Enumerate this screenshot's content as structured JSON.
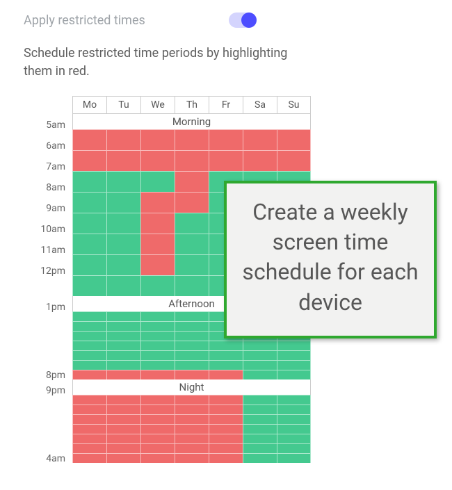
{
  "header": {
    "title": "Apply restricted times",
    "toggle_on": true
  },
  "description": "Schedule restricted time periods by highlighting them in red.",
  "days": [
    "Mo",
    "Tu",
    "We",
    "Th",
    "Fr",
    "Sa",
    "Su"
  ],
  "sections": {
    "morning": {
      "label": "Morning",
      "rows": [
        {
          "label": "5am",
          "cells": [
            "r",
            "r",
            "r",
            "r",
            "r",
            "r",
            "r"
          ]
        },
        {
          "label": "6am",
          "cells": [
            "r",
            "r",
            "r",
            "r",
            "r",
            "r",
            "r"
          ]
        },
        {
          "label": "7am",
          "cells": [
            "g",
            "g",
            "g",
            "r",
            "g",
            "g",
            "g"
          ]
        },
        {
          "label": "8am",
          "cells": [
            "g",
            "g",
            "r",
            "r",
            "g",
            "g",
            "g"
          ]
        },
        {
          "label": "9am",
          "cells": [
            "g",
            "g",
            "r",
            "g",
            "g",
            "g",
            "g"
          ]
        },
        {
          "label": "10am",
          "cells": [
            "g",
            "g",
            "r",
            "g",
            "g",
            "g",
            "g"
          ]
        },
        {
          "label": "11am",
          "cells": [
            "g",
            "g",
            "r",
            "g",
            "g",
            "g",
            "g"
          ]
        },
        {
          "label": "12pm",
          "cells": [
            "g",
            "g",
            "g",
            "g",
            "g",
            "g",
            "g"
          ]
        }
      ]
    },
    "afternoon": {
      "label": "Afternoon",
      "top_label": "1pm",
      "bottom_label": "8pm",
      "rows": [
        {
          "cells": [
            "g",
            "g",
            "g",
            "g",
            "g",
            "g",
            "g"
          ]
        },
        {
          "cells": [
            "g",
            "g",
            "g",
            "g",
            "g",
            "g",
            "g"
          ]
        },
        {
          "cells": [
            "g",
            "g",
            "g",
            "g",
            "g",
            "g",
            "g"
          ]
        },
        {
          "cells": [
            "g",
            "g",
            "g",
            "g",
            "g",
            "g",
            "g"
          ]
        },
        {
          "cells": [
            "g",
            "g",
            "g",
            "g",
            "g",
            "g",
            "g"
          ]
        },
        {
          "cells": [
            "g",
            "g",
            "g",
            "g",
            "g",
            "g",
            "g"
          ]
        },
        {
          "cells": [
            "r",
            "r",
            "r",
            "r",
            "r",
            "g",
            "g"
          ]
        }
      ]
    },
    "night": {
      "label": "Night",
      "top_label": "9pm",
      "bottom_label": "4am",
      "rows": [
        {
          "cells": [
            "r",
            "r",
            "r",
            "r",
            "r",
            "g",
            "g"
          ]
        },
        {
          "cells": [
            "r",
            "r",
            "r",
            "r",
            "r",
            "g",
            "g"
          ]
        },
        {
          "cells": [
            "r",
            "r",
            "r",
            "r",
            "r",
            "g",
            "g"
          ]
        },
        {
          "cells": [
            "r",
            "r",
            "r",
            "r",
            "r",
            "g",
            "g"
          ]
        },
        {
          "cells": [
            "r",
            "r",
            "r",
            "r",
            "r",
            "g",
            "g"
          ]
        },
        {
          "cells": [
            "r",
            "r",
            "r",
            "r",
            "r",
            "g",
            "g"
          ]
        },
        {
          "cells": [
            "r",
            "r",
            "r",
            "r",
            "r",
            "g",
            "g"
          ]
        }
      ]
    }
  },
  "callout": "Create a weekly screen time schedule for each device",
  "colors": {
    "restricted": "#ef6a6a",
    "allowed": "#44c98f",
    "toggle": "#4d4dff",
    "callout_border": "#2fa82f"
  }
}
